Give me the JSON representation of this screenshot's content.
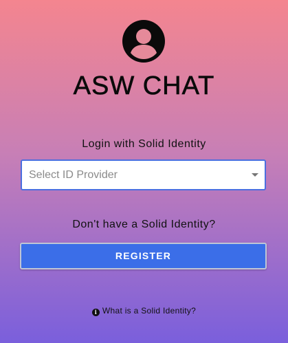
{
  "app": {
    "title": "ASW CHAT",
    "avatar_icon": "account-circle-icon"
  },
  "login": {
    "label": "Login with Solid Identity",
    "provider_select": {
      "placeholder": "Select ID Provider",
      "value": ""
    }
  },
  "register": {
    "prompt": "Don't have a Solid Identity?",
    "button_label": "REGISTER"
  },
  "help": {
    "icon": "info-icon",
    "info_glyph": "i",
    "link_text": "What is a Solid Identity?"
  },
  "colors": {
    "gradient_top": "#f4858f",
    "gradient_bottom": "#7a5fdc",
    "primary": "#3b6ee8",
    "select_border": "#4a6fe0"
  }
}
